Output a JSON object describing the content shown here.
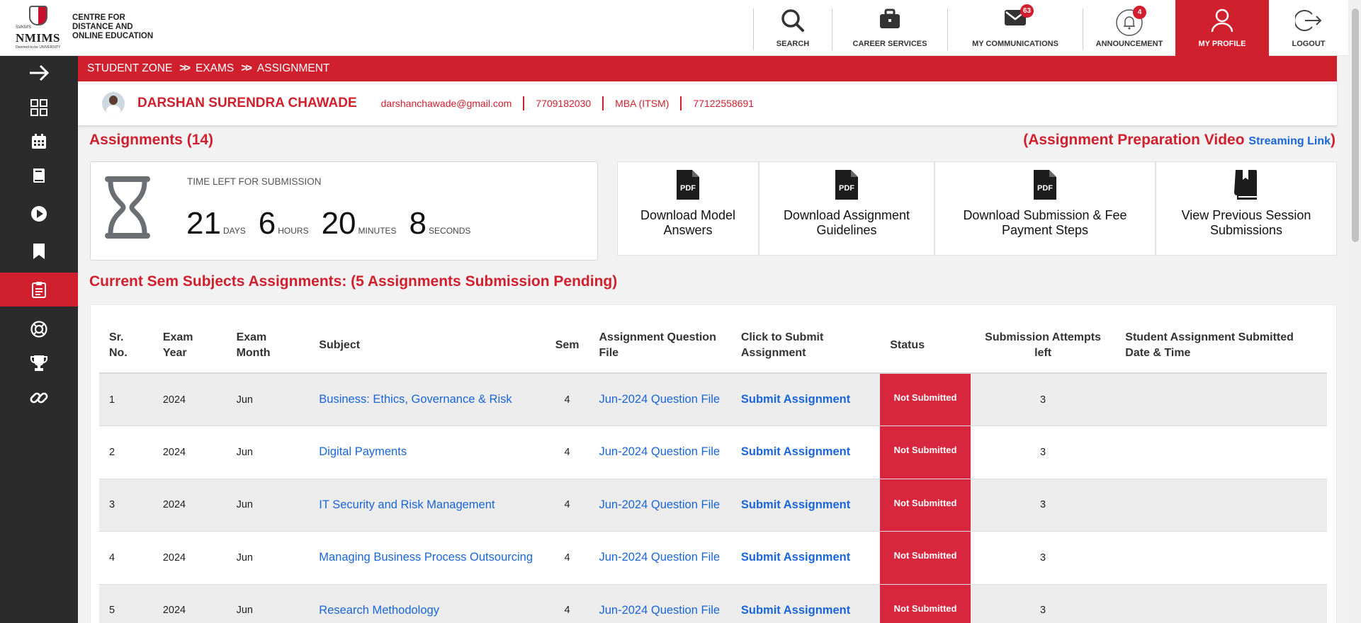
{
  "logo": {
    "brand": "NMIMS",
    "pre": "SVKM'S",
    "sub": "Deemed-to-be UNIVERSITY",
    "line1": "CENTRE FOR",
    "line2": "DISTANCE AND",
    "line3": "ONLINE EDUCATION"
  },
  "topnav": {
    "search": "SEARCH",
    "career": "CAREER SERVICES",
    "communications": "MY COMMUNICATIONS",
    "communications_count": "63",
    "announcement": "ANNOUNCEMENT",
    "announcement_count": "4",
    "profile": "MY PROFILE",
    "logout": "LOGOUT"
  },
  "sidebar": {
    "icons": [
      "arrow-right-icon",
      "grid-icon",
      "calendar-icon",
      "book-icon",
      "play-icon",
      "bookmark-icon",
      "clipboard-icon",
      "lifebuoy-icon",
      "trophy-icon",
      "link-icon"
    ],
    "active": "clipboard-icon"
  },
  "breadcrumb": [
    "STUDENT ZONE",
    "EXAMS",
    "ASSIGNMENT"
  ],
  "profile": {
    "name": "DARSHAN SURENDRA CHAWADE",
    "email": "darshanchawade@gmail.com",
    "phone": "7709182030",
    "program": "MBA (ITSM)",
    "student_id": "77122558691"
  },
  "assignments_heading": "Assignments (14)",
  "video": {
    "prefix": "(Assignment Preparation Video",
    "link": "Streaming Link",
    "suffix": ")"
  },
  "timer": {
    "label": "TIME LEFT FOR SUBMISSION",
    "days": "21",
    "days_unit": "DAYS",
    "hours": "6",
    "hours_unit": "HOURS",
    "minutes": "20",
    "minutes_unit": "MINUTES",
    "seconds": "8",
    "seconds_unit": "SECONDS"
  },
  "downloads": {
    "model_answers": "Download Model Answers",
    "guidelines": "Download Assignment Guidelines",
    "submission_steps": "Download Submission & Fee Payment Steps",
    "previous_session": "View Previous Session Submissions"
  },
  "current_heading": "Current Sem Subjects Assignments: (5 Assignments Submission Pending)",
  "table": {
    "headers": {
      "sr": "Sr. No.",
      "year": "Exam Year",
      "month": "Exam Month",
      "subject": "Subject",
      "sem": "Sem",
      "question": "Assignment Question File",
      "submit": "Click to Submit Assignment",
      "status": "Status",
      "attempts": "Submission Attempts left",
      "submitted": "Student Assignment Submitted Date & Time"
    },
    "rows": [
      {
        "sr": "1",
        "year": "2024",
        "month": "Jun",
        "subject": "Business: Ethics, Governance & Risk",
        "sem": "4",
        "question": "Jun-2024 Question File",
        "submit": "Submit Assignment",
        "status": "Not Submitted",
        "attempts": "3",
        "submitted": ""
      },
      {
        "sr": "2",
        "year": "2024",
        "month": "Jun",
        "subject": "Digital Payments",
        "sem": "4",
        "question": "Jun-2024 Question File",
        "submit": "Submit Assignment",
        "status": "Not Submitted",
        "attempts": "3",
        "submitted": ""
      },
      {
        "sr": "3",
        "year": "2024",
        "month": "Jun",
        "subject": "IT Security and Risk Management",
        "sem": "4",
        "question": "Jun-2024 Question File",
        "submit": "Submit Assignment",
        "status": "Not Submitted",
        "attempts": "3",
        "submitted": ""
      },
      {
        "sr": "4",
        "year": "2024",
        "month": "Jun",
        "subject": "Managing Business Process Outsourcing",
        "sem": "4",
        "question": "Jun-2024 Question File",
        "submit": "Submit Assignment",
        "status": "Not Submitted",
        "attempts": "3",
        "submitted": ""
      },
      {
        "sr": "5",
        "year": "2024",
        "month": "Jun",
        "subject": "Research Methodology",
        "sem": "4",
        "question": "Jun-2024 Question File",
        "submit": "Submit Assignment",
        "status": "Not Submitted",
        "attempts": "3",
        "submitted": ""
      }
    ]
  },
  "colors": {
    "brand_red": "#d0202e",
    "link_blue": "#1a66d9",
    "sidebar_bg": "#2b2b2b"
  }
}
